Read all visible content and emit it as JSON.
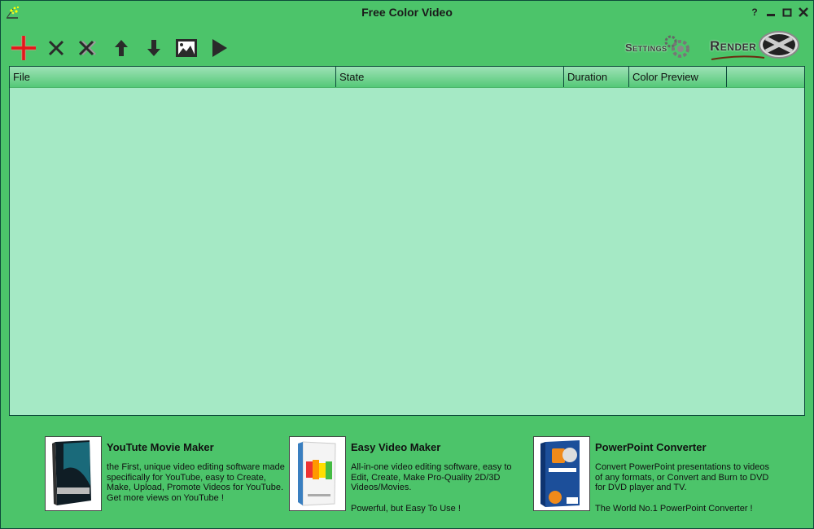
{
  "window": {
    "title": "Free Color Video",
    "controls": {
      "help": "?",
      "minimize": "_",
      "maximize": "□",
      "close": "X"
    }
  },
  "toolbar": {
    "buttons": [
      {
        "name": "add",
        "icon": "plus-icon"
      },
      {
        "name": "remove",
        "icon": "x-icon"
      },
      {
        "name": "remove-all",
        "icon": "double-x-icon"
      },
      {
        "name": "move-up",
        "icon": "arrow-up-icon"
      },
      {
        "name": "move-down",
        "icon": "arrow-down-icon"
      },
      {
        "name": "image",
        "icon": "image-icon"
      },
      {
        "name": "play",
        "icon": "play-icon"
      }
    ],
    "settings_label": "Settings",
    "render_label": "Render"
  },
  "file_list": {
    "columns": [
      "File",
      "State",
      "Duration",
      "Color Preview"
    ],
    "rows": []
  },
  "promos": [
    {
      "title": "YouTute Movie Maker",
      "description": "the First, unique video editing software made specifically for YouTube, easy to Create, Make, Upload, Promote Videos for YouTube.\nGet more views on YouTube !"
    },
    {
      "title": "Easy Video Maker",
      "description": "All-in-one video editing software, easy to Edit, Create, Make Pro-Quality 2D/3D Videos/Movies.\n\nPowerful, but Easy To Use !"
    },
    {
      "title": "PowerPoint Converter",
      "description": "Convert PowerPoint presentations to videos of any formats, or Convert and Burn to DVD for DVD player and TV.\n\nThe World No.1 PowerPoint Converter !"
    }
  ]
}
